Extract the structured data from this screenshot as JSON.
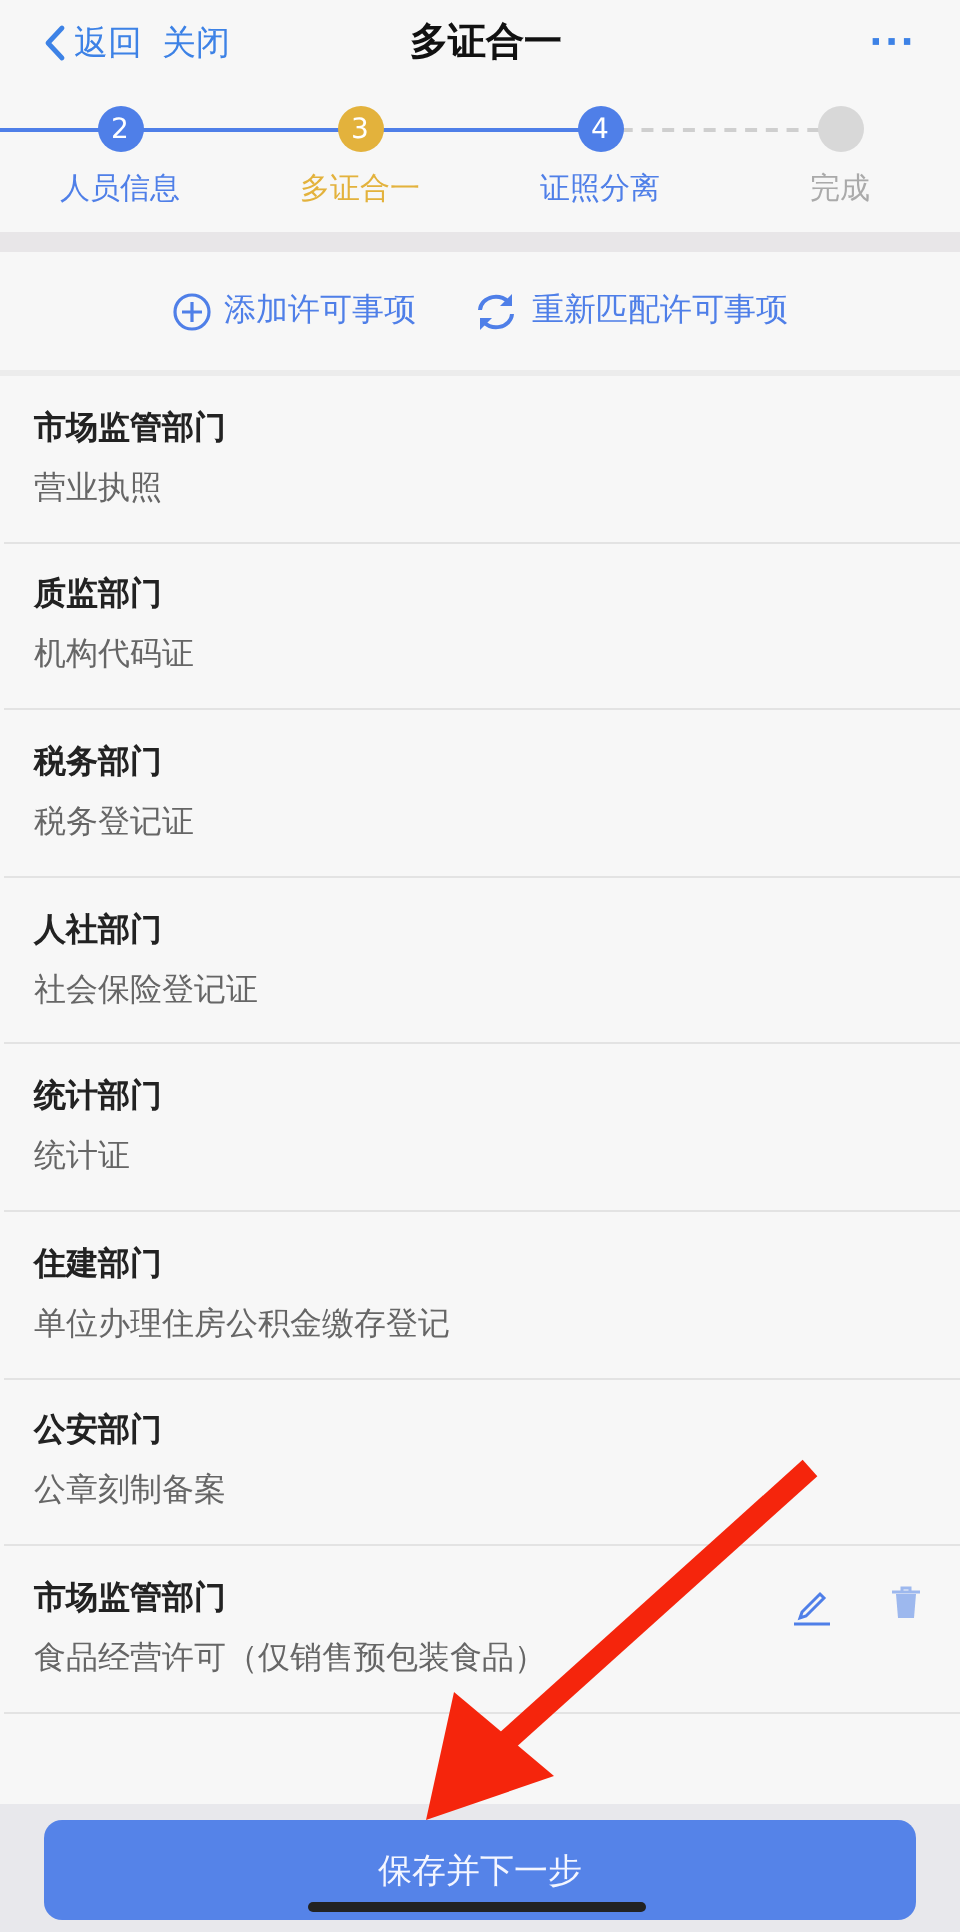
{
  "nav": {
    "back": "返回",
    "close": "关闭",
    "title": "多证合一",
    "more": "···"
  },
  "steps": [
    {
      "number": "2",
      "label": "人员信息",
      "selected": false,
      "completed": true
    },
    {
      "number": "3",
      "label": "多证合一",
      "selected": true,
      "completed": false
    },
    {
      "number": "4",
      "label": "证照分离",
      "selected": false,
      "completed": true
    },
    {
      "label": "完成",
      "selected": false,
      "completed": false
    }
  ],
  "actions": [
    "添加许可事项",
    "重新匹配许可事项"
  ],
  "items": [
    {
      "department": "市场监管部门",
      "license": "营业执照",
      "kind": "fixed"
    },
    {
      "department": "质监部门",
      "license": "机构代码证",
      "kind": "fixed"
    },
    {
      "department": "税务部门",
      "license": "税务登记证",
      "kind": "fixed"
    },
    {
      "department": "人社部门",
      "license": "社会保险登记证",
      "kind": "fixed"
    },
    {
      "department": "统计部门",
      "license": "统计证",
      "kind": "fixed"
    },
    {
      "department": "住建部门",
      "license": "单位办理住房公积金缴存登记",
      "kind": "fixed"
    },
    {
      "department": "公安部门",
      "license": "公章刻制备案",
      "kind": "fixed"
    },
    {
      "department": "市场监管部门",
      "license": "食品经营许可（仅销售预包装食品）",
      "kind": "editable"
    }
  ],
  "submit": "保存并下一步"
}
